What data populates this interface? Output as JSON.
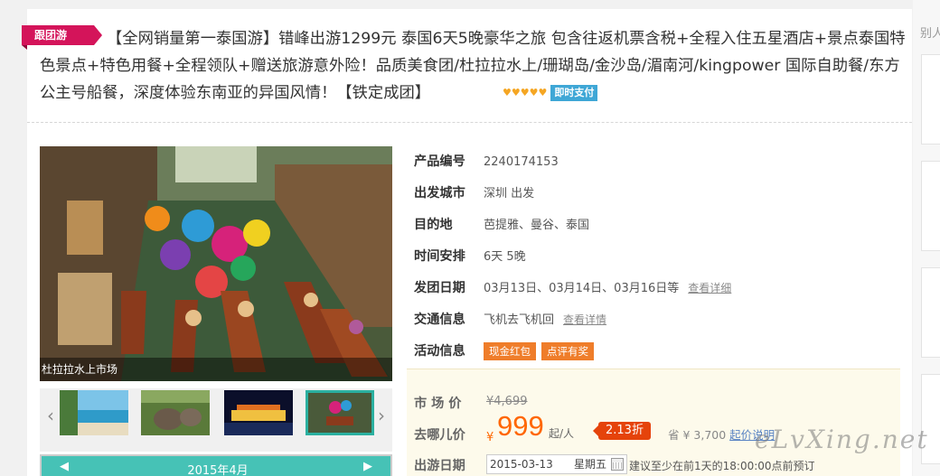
{
  "sidebar": {
    "label": "别人"
  },
  "product": {
    "tag": "跟团游",
    "title": "【全网销量第一泰国游】错峰出游1299元 泰国6天5晚豪华之旅 包含往返机票含税+全程入住五星酒店+景点泰国特色景点+特色用餐+全程领队+赠送旅游意外险！品质美食团/杜拉拉水上/珊瑚岛/金沙岛/湄南河/kingpower 国际自助餐/东方公主号船餐，深度体验东南亚的异国风情！【铁定成团】",
    "stars": "♥♥♥♥♥",
    "pay_badge": "即时支付"
  },
  "gallery": {
    "caption": "杜拉拉水上市场",
    "prev_icon": "chevron-left-icon",
    "next_icon": "chevron-right-icon",
    "calendar_month": "2015年4月"
  },
  "info": {
    "code_label": "产品编号",
    "code": "2240174153",
    "city_label": "出发城市",
    "city": "深圳 出发",
    "dest_label": "目的地",
    "dest": "芭提雅、曼谷、泰国",
    "time_label": "时间安排",
    "time": "6天 5晚",
    "dates_label": "发团日期",
    "dates": "03月13日、03月14日、03月16日等",
    "dates_link": "查看详细",
    "traffic_label": "交通信息",
    "traffic": "飞机去飞机回",
    "traffic_link": "查看详情",
    "promo_label": "活动信息",
    "promo1": "现金红包",
    "promo2": "点评有奖"
  },
  "price": {
    "market_label": "市 场 价",
    "market": "¥4,699",
    "qunar_label": "去哪儿价",
    "currency": "¥",
    "amount": "999",
    "per": "起/人",
    "discount": "2.13折",
    "save": "省 ¥ 3,700",
    "save_link": "起价说明",
    "date_label": "出游日期",
    "date": "2015-03-13",
    "weekday": "星期五",
    "hint": "建议至少在前1天的18:00:00点前预订"
  },
  "watermark": "eLvXing.net"
}
